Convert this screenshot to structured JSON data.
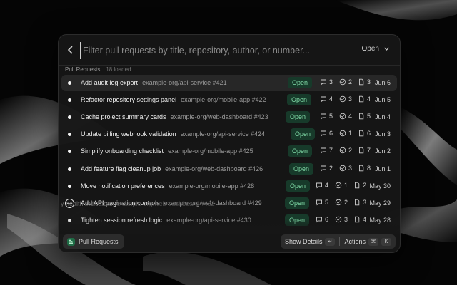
{
  "search": {
    "placeholder": "Filter pull requests by title, repository, author, or number..."
  },
  "filter": {
    "selected": "Open"
  },
  "section": {
    "title": "Pull Requests",
    "count": "18 loaded"
  },
  "rows": [
    {
      "title": "Add audit log export",
      "repo": "example-org/api-service #421",
      "status": "Open",
      "comments": "3",
      "approvals": "2",
      "files": "3",
      "date": "Jun 6",
      "selected": true
    },
    {
      "title": "Refactor repository settings panel",
      "repo": "example-org/mobile-app #422",
      "status": "Open",
      "comments": "4",
      "approvals": "3",
      "files": "4",
      "date": "Jun 5"
    },
    {
      "title": "Cache project summary cards",
      "repo": "example-org/web-dashboard #423",
      "status": "Open",
      "comments": "5",
      "approvals": "4",
      "files": "5",
      "date": "Jun 4"
    },
    {
      "title": "Update billing webhook validation",
      "repo": "example-org/api-service #424",
      "status": "Open",
      "comments": "6",
      "approvals": "1",
      "files": "6",
      "date": "Jun 3"
    },
    {
      "title": "Simplify onboarding checklist",
      "repo": "example-org/mobile-app #425",
      "status": "Open",
      "comments": "7",
      "approvals": "2",
      "files": "7",
      "date": "Jun 2"
    },
    {
      "title": "Add feature flag cleanup job",
      "repo": "example-org/web-dashboard #426",
      "status": "Open",
      "comments": "2",
      "approvals": "3",
      "files": "8",
      "date": "Jun 1"
    },
    {
      "title": "Move notification preferences",
      "repo": "example-org/mobile-app #428",
      "status": "Open",
      "comments": "4",
      "approvals": "1",
      "files": "2",
      "date": "May 30"
    },
    {
      "title": "Add API pagination controls",
      "repo": "example-org/web-dashboard #429",
      "status": "Open",
      "comments": "5",
      "approvals": "2",
      "files": "3",
      "date": "May 29",
      "more": true
    },
    {
      "title": "Tighten session refresh logic",
      "repo": "example-org/api-service #430",
      "status": "Open",
      "comments": "6",
      "approvals": "3",
      "files": "4",
      "date": "May 28"
    }
  ],
  "faded_row": {
    "title": "y health indicators",
    "repo": "example-org/web-dashboard #432"
  },
  "bottom": {
    "chip_label": "Pull Requests",
    "show_details": "Show Details",
    "show_details_key": "↵",
    "actions": "Actions",
    "actions_key_1": "⌘",
    "actions_key_2": "K"
  },
  "colors": {
    "badge_bg": "#173a2a",
    "badge_text": "#7fd9a6",
    "panel_bg": "#161616"
  },
  "icons": [
    "chevron-left-icon",
    "chevron-down-icon",
    "comment-icon",
    "check-circle-icon",
    "file-icon",
    "more-icon",
    "pull-request-icon"
  ]
}
